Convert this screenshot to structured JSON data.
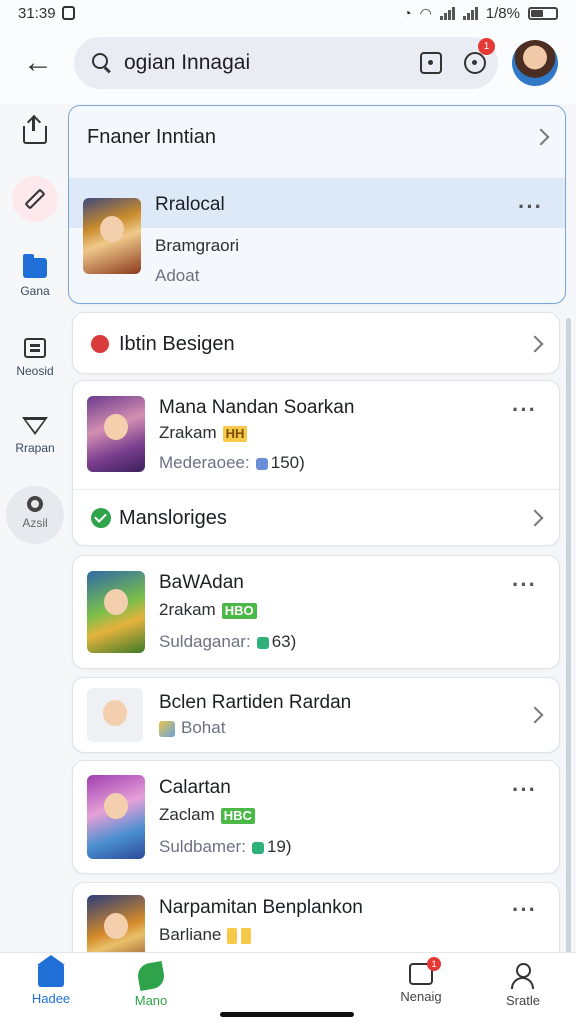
{
  "status_bar": {
    "time": "31:39",
    "battery": "1/8%"
  },
  "header": {
    "search_value": "ogian Innagai",
    "notification_count": "1"
  },
  "sidebar": {
    "items": [
      {
        "icon": "upload-icon",
        "label": ""
      },
      {
        "icon": "pen-icon",
        "label": ""
      },
      {
        "icon": "folder-icon",
        "label": "Gana"
      },
      {
        "icon": "document-icon",
        "label": "Neosid"
      },
      {
        "icon": "triangle-icon",
        "label": "Rrapan"
      },
      {
        "icon": "gear-icon",
        "label": "Azsil"
      }
    ]
  },
  "section1": {
    "title": "Fnaner Inntian",
    "item": {
      "title": "Rralocal",
      "subtitle": "Bramgraori",
      "meta": "Adoat"
    }
  },
  "section2": {
    "title": "Ibtin Besigen"
  },
  "item2": {
    "title": "Mana Nandan Soarkan",
    "subtitle": "Zrakam",
    "tag": "HH",
    "meta": "Mederaoee:",
    "meta_value": "150)"
  },
  "section3": {
    "title": "Mansloriges"
  },
  "item3": {
    "title": "BaWAdan",
    "subtitle": "2rakam",
    "tag": "HBO",
    "meta": "Suldaganar:",
    "meta_value": "63)"
  },
  "item4": {
    "title": "Bclen Rartiden Rardan",
    "meta": "Bohat"
  },
  "item5": {
    "title": "Calartan",
    "subtitle": "Zaclam",
    "tag": "HBC",
    "meta": "Suldbamer:",
    "meta_value": "19)"
  },
  "item6": {
    "title": "Narpamitan Benplankon",
    "subtitle": "Barliane"
  },
  "bottom_nav": {
    "items": [
      {
        "label": "Hadee"
      },
      {
        "label": "Mano"
      },
      {
        "label": "Nenaig",
        "badge": "1"
      },
      {
        "label": "Sratle"
      }
    ]
  }
}
